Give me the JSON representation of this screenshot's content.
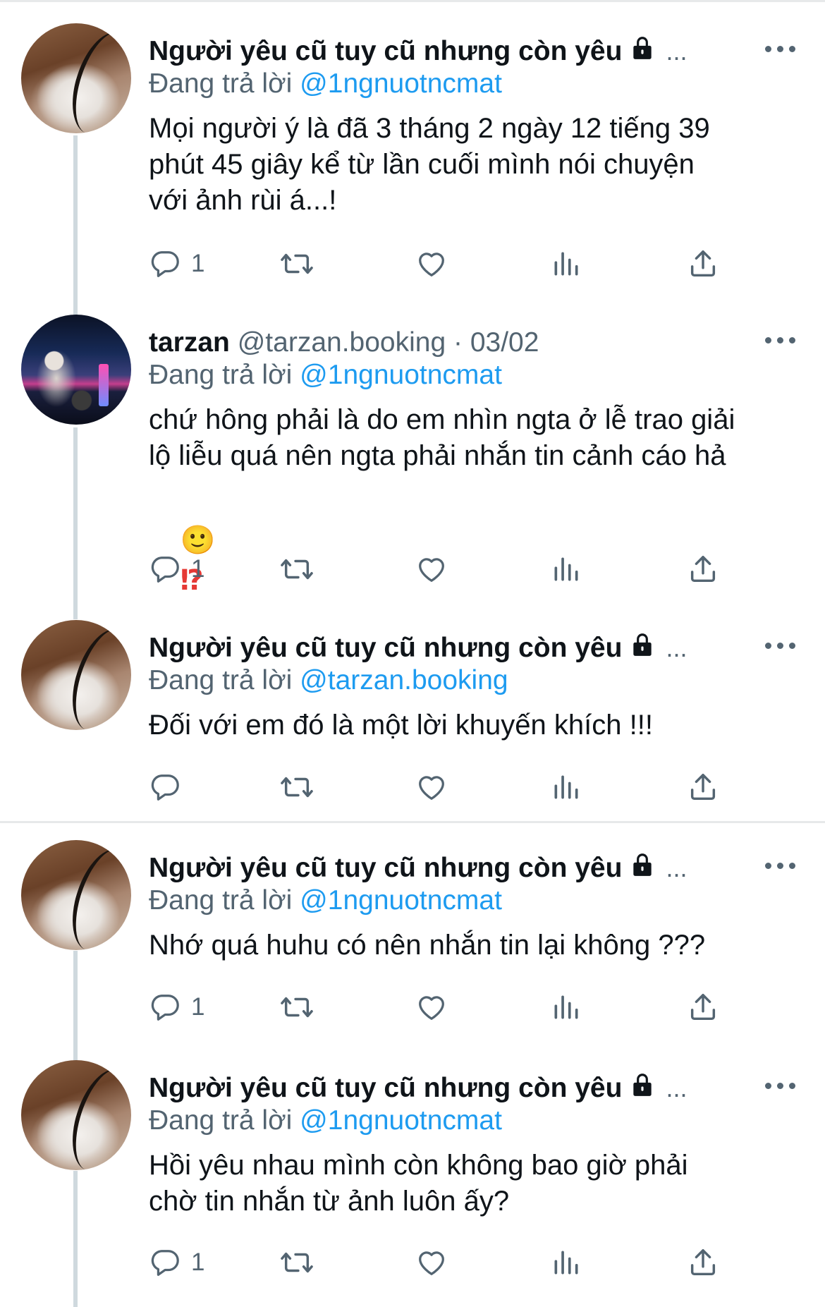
{
  "tweets": [
    {
      "name": "Người yêu cũ tuy cũ nhưng còn yêu",
      "handle": "",
      "date": "",
      "locked": true,
      "truncated": "...",
      "reply_prefix": "Đang trả lời",
      "reply_to": "@1ngnuotncmat",
      "text": "Mọi người ý là đã 3 tháng 2 ngày 12 tiếng 39\nphút 45 giây kể từ lần cuối mình nói chuyện\nvới ảnh rùi á...!",
      "reply_count": "1",
      "avatar": "cat-avatar"
    },
    {
      "name": "tarzan",
      "handle": "@tarzan.booking",
      "date": "· 03/02",
      "locked": false,
      "truncated": "",
      "reply_prefix": "Đang trả lời",
      "reply_to": "@1ngnuotncmat",
      "text": "chứ hông phải là do em nhìn ngta ở lễ trao giải\nlộ liễu quá nên ngta phải nhắn tin cảnh cáo hả",
      "emojis": [
        "🙂",
        "⁉"
      ],
      "reply_count": "1",
      "avatar": "city-avatar"
    },
    {
      "name": "Người yêu cũ tuy cũ nhưng còn yêu",
      "handle": "",
      "date": "",
      "locked": true,
      "truncated": "...",
      "reply_prefix": "Đang trả lời",
      "reply_to": "@tarzan.booking",
      "text": "Đối với em đó là một lời khuyến khích !!!",
      "reply_count": "",
      "avatar": "cat-avatar"
    },
    {
      "name": "Người yêu cũ tuy cũ nhưng còn yêu",
      "handle": "",
      "date": "",
      "locked": true,
      "truncated": "...",
      "reply_prefix": "Đang trả lời",
      "reply_to": "@1ngnuotncmat",
      "text": "Nhớ quá huhu có nên nhắn tin lại không ???",
      "reply_count": "1",
      "avatar": "cat-avatar"
    },
    {
      "name": "Người yêu cũ tuy cũ nhưng còn yêu",
      "handle": "",
      "date": "",
      "locked": true,
      "truncated": "...",
      "reply_prefix": "Đang trả lời",
      "reply_to": "@1ngnuotncmat",
      "text": "Hồi yêu nhau mình còn không bao giờ phải\nchờ tin nhắn từ ảnh luôn ấy?",
      "reply_count": "1",
      "avatar": "cat-avatar"
    }
  ],
  "icons": {
    "reply": "reply-icon",
    "retweet": "retweet-icon",
    "like": "heart-icon",
    "analytics": "analytics-icon",
    "share": "share-icon",
    "more": "more-icon",
    "lock": "lock-icon"
  },
  "colors": {
    "link": "#1d9bf0",
    "secondary_text": "#536471",
    "text": "#0f1419",
    "thread_line": "#cfd9de"
  }
}
